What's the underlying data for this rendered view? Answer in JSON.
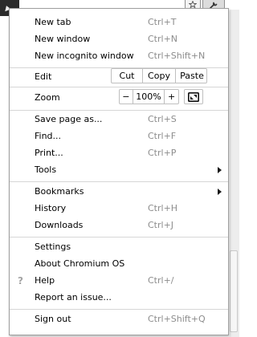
{
  "menu": {
    "new_tab": {
      "label": "New tab",
      "shortcut": "Ctrl+T"
    },
    "new_window": {
      "label": "New window",
      "shortcut": "Ctrl+N"
    },
    "new_incognito_window": {
      "label": "New incognito window",
      "shortcut": "Ctrl+Shift+N"
    },
    "edit": {
      "label": "Edit",
      "cut": "Cut",
      "copy": "Copy",
      "paste": "Paste"
    },
    "zoom": {
      "label": "Zoom",
      "minus": "−",
      "level": "100%",
      "plus": "+",
      "fullscreen_icon": "fullscreen-icon"
    },
    "save_page_as": {
      "label": "Save page as...",
      "shortcut": "Ctrl+S"
    },
    "find": {
      "label": "Find...",
      "shortcut": "Ctrl+F"
    },
    "print": {
      "label": "Print...",
      "shortcut": "Ctrl+P"
    },
    "tools": {
      "label": "Tools"
    },
    "bookmarks": {
      "label": "Bookmarks"
    },
    "history": {
      "label": "History",
      "shortcut": "Ctrl+H"
    },
    "downloads": {
      "label": "Downloads",
      "shortcut": "Ctrl+J"
    },
    "settings": {
      "label": "Settings"
    },
    "about": {
      "label": "About Chromium OS"
    },
    "help": {
      "label": "Help",
      "shortcut": "Ctrl+/",
      "icon": "?"
    },
    "report_issue": {
      "label": "Report an issue..."
    },
    "sign_out": {
      "label": "Sign out",
      "shortcut": "Ctrl+Shift+Q"
    }
  },
  "toolbar": {
    "star_icon": "star-icon",
    "wrench_icon": "wrench-icon"
  },
  "colors": {
    "shortcut_text": "#8c8c8c",
    "separator": "#d6d6d6",
    "menu_border": "#9f9f9f"
  }
}
